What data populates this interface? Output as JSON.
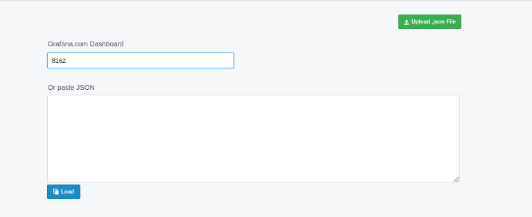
{
  "upload_button": {
    "label": "Upload .json File",
    "icon": "upload-icon"
  },
  "grafana_dashboard": {
    "label": "Grafana.com Dashboard",
    "value": "8162"
  },
  "paste_json": {
    "label": "Or paste JSON",
    "value": ""
  },
  "load_button": {
    "label": "Load",
    "icon": "copy-icon"
  },
  "colors": {
    "upload_button_bg": "#3aae4f",
    "load_button_bg": "#1b8cc7",
    "page_bg": "#f6f7f9",
    "input_focus_border": "#5ab5e6"
  }
}
